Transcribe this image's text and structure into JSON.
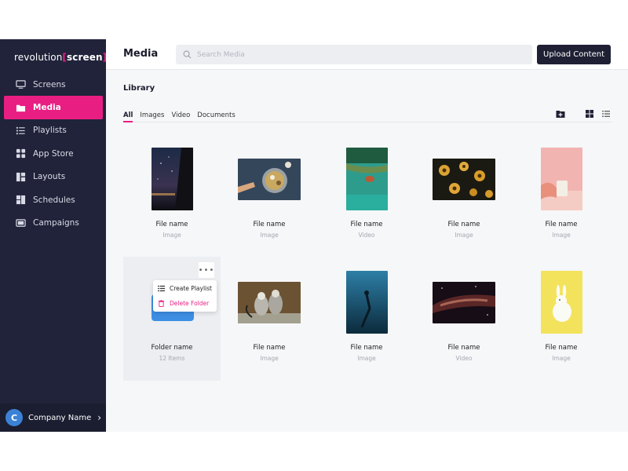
{
  "app": {
    "logo": {
      "prefix": "revolution",
      "open": "[",
      "brand": "screen",
      "close": "]"
    }
  },
  "sidebar": {
    "items": [
      {
        "label": "Screens",
        "icon": "monitor-icon",
        "active": false
      },
      {
        "label": "Media",
        "icon": "folder-icon",
        "active": true
      },
      {
        "label": "Playlists",
        "icon": "playlist-icon",
        "active": false
      },
      {
        "label": "App Store",
        "icon": "apps-icon",
        "active": false
      },
      {
        "label": "Layouts",
        "icon": "layout-icon",
        "active": false
      },
      {
        "label": "Schedules",
        "icon": "schedule-icon",
        "active": false
      },
      {
        "label": "Campaigns",
        "icon": "campaign-icon",
        "active": false
      }
    ],
    "company": {
      "initial": "C",
      "name": "Company Name"
    }
  },
  "header": {
    "title": "Media",
    "search_placeholder": "Search Media",
    "upload_label": "Upload Content"
  },
  "library": {
    "title": "Library",
    "tabs": [
      "All",
      "Images",
      "Video",
      "Documents"
    ],
    "active_tab": "All"
  },
  "items": [
    {
      "name": "File name",
      "type": "Image"
    },
    {
      "name": "File name",
      "type": "Image"
    },
    {
      "name": "File name",
      "type": "Video"
    },
    {
      "name": "File name",
      "type": "Image"
    },
    {
      "name": "File name",
      "type": "Image"
    },
    {
      "name": "Folder name",
      "type": "12 Items"
    },
    {
      "name": "File name",
      "type": "Image"
    },
    {
      "name": "File name",
      "type": "Image"
    },
    {
      "name": "File name",
      "type": "Video"
    },
    {
      "name": "File name",
      "type": "Image"
    }
  ],
  "context_menu": {
    "create_playlist": "Create Playlist",
    "delete_folder": "Delete Folder"
  },
  "colors": {
    "accent": "#e91e82",
    "sidebar": "#21233a",
    "button": "#1f2034",
    "folder": "#3e8fe4"
  }
}
